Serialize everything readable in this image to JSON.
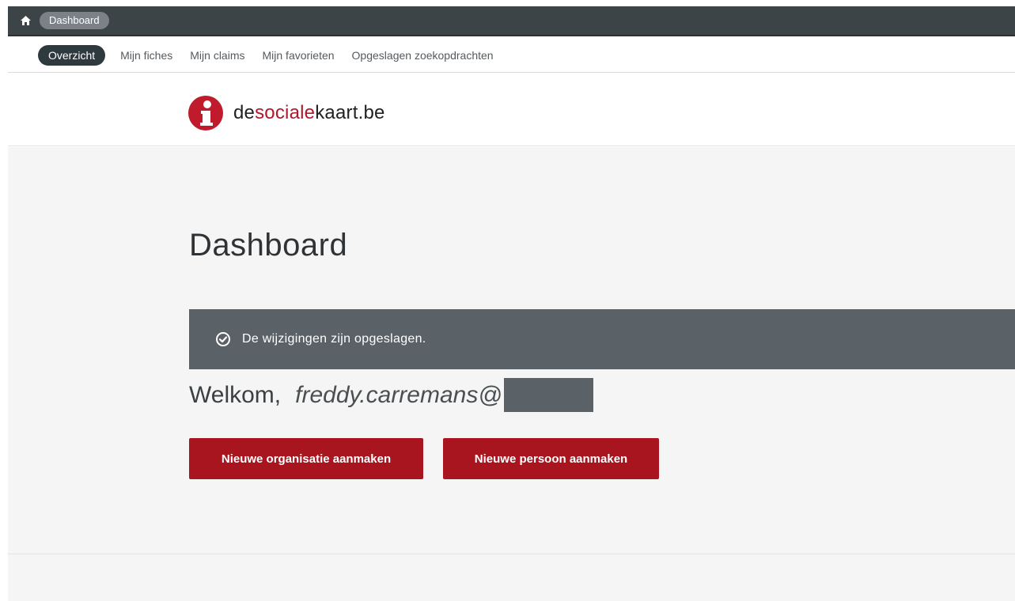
{
  "topbar": {
    "home_icon": "home-icon",
    "breadcrumb": "Dashboard"
  },
  "subnav": {
    "items": [
      {
        "label": "Overzicht",
        "active": true
      },
      {
        "label": "Mijn fiches",
        "active": false
      },
      {
        "label": "Mijn claims",
        "active": false
      },
      {
        "label": "Mijn favorieten",
        "active": false
      },
      {
        "label": "Opgeslagen zoekopdrachten",
        "active": false
      }
    ]
  },
  "logo": {
    "icon": "info-icon",
    "part1": "de",
    "part2": "sociale",
    "part3": "kaart.be"
  },
  "main": {
    "title": "Dashboard",
    "alert": {
      "icon": "check-circle-icon",
      "text": "De wijzigingen zijn opgeslagen."
    },
    "welcome_label": "Welkom,",
    "welcome_email": "freddy.carremans@",
    "buttons": {
      "new_org": "Nieuwe organisatie aanmaken",
      "new_person": "Nieuwe persoon aanmaken"
    }
  },
  "colors": {
    "topbar": "#3d4448",
    "accent_red": "#a8151f",
    "alert_bg": "#5b6267",
    "main_bg": "#f5f5f5"
  }
}
